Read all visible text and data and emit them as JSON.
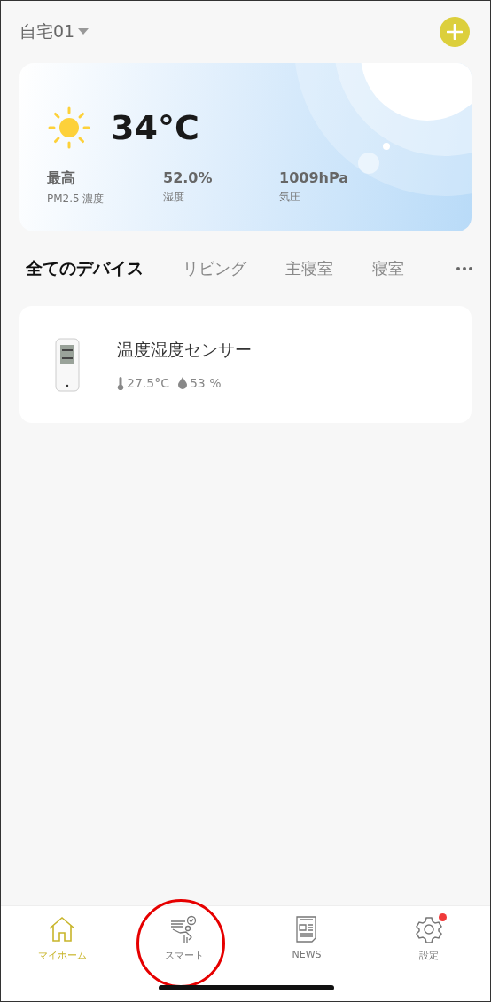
{
  "header": {
    "home_name": "自宅01"
  },
  "weather": {
    "temperature": "34°C",
    "stats": [
      {
        "value": "最高",
        "label": "PM2.5 濃度"
      },
      {
        "value": "52.0%",
        "label": "湿度"
      },
      {
        "value": "1009hPa",
        "label": "気圧"
      }
    ]
  },
  "room_tabs": [
    {
      "label": "全てのデバイス",
      "selected": true
    },
    {
      "label": "リビング",
      "selected": false
    },
    {
      "label": "主寝室",
      "selected": false
    },
    {
      "label": "寝室",
      "selected": false
    }
  ],
  "devices": [
    {
      "name": "温度湿度センサー",
      "temperature": "27.5°C",
      "humidity": "53 %"
    }
  ],
  "tab_bar": [
    {
      "kind": "home",
      "label": "マイホーム",
      "selected": true,
      "badge": false,
      "circled": false
    },
    {
      "kind": "smart",
      "label": "スマート",
      "selected": false,
      "badge": false,
      "circled": true
    },
    {
      "kind": "news",
      "label": "NEWS",
      "selected": false,
      "badge": false,
      "circled": false
    },
    {
      "kind": "settings",
      "label": "設定",
      "selected": false,
      "badge": true,
      "circled": false
    }
  ]
}
